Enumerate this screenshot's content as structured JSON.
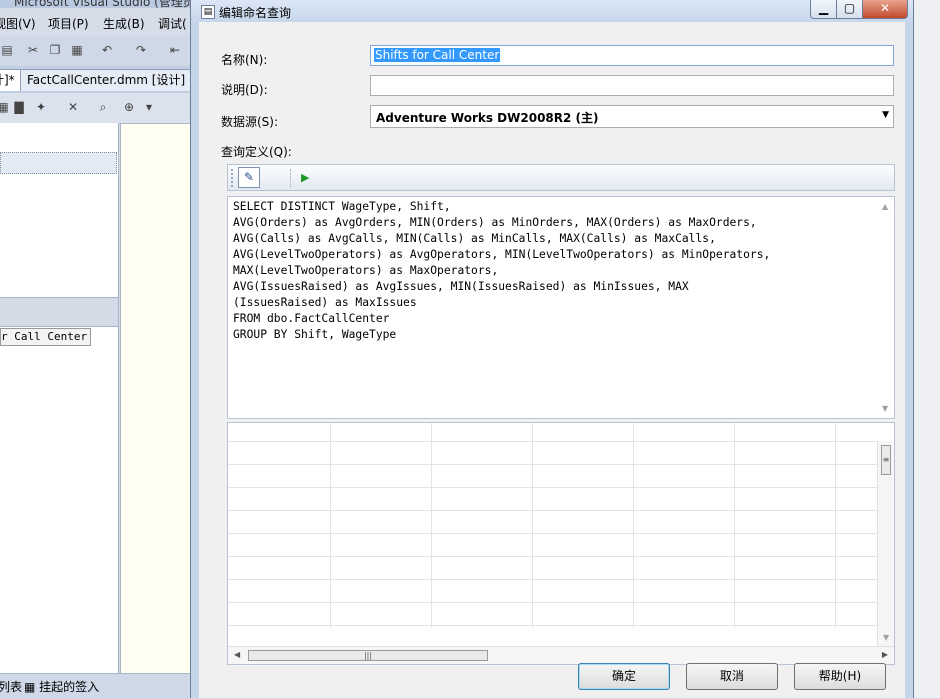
{
  "vs": {
    "title": "Microsoft Visual Studio (管理员)",
    "menu": [
      "视图(V)",
      "项目(P)",
      "生成(B)",
      "调试("
    ],
    "tabs": {
      "active_fragment": "计]*",
      "fact": "FactCallCenter.dmm [设计]"
    },
    "left_item": "r Call Center",
    "status_tabs": [
      "列表",
      "挂起的签入"
    ]
  },
  "dialog": {
    "title": "编辑命名查询",
    "name_label": "名称(N):",
    "name_value": "Shifts for Call Center",
    "description_label": "说明(D):",
    "description_value": "",
    "datasource_label": "数据源(S):",
    "datasource_value": "Adventure Works DW2008R2 (主)",
    "query_label": "查询定义(Q):",
    "sql_lines": [
      "SELECT DISTINCT WageType, Shift,",
      "AVG(Orders) as AvgOrders, MIN(Orders) as MinOrders, MAX(Orders) as MaxOrders,",
      "AVG(Calls) as AvgCalls, MIN(Calls) as MinCalls, MAX(Calls) as MaxCalls,",
      "AVG(LevelTwoOperators) as AvgOperators, MIN(LevelTwoOperators) as MinOperators,",
      "MAX(LevelTwoOperators) as MaxOperators,",
      "AVG(IssuesRaised) as AvgIssues, MIN(IssuesRaised) as MinIssues, MAX",
      "(IssuesRaised) as MaxIssues",
      "FROM dbo.FactCallCenter",
      "GROUP BY Shift, WageType"
    ],
    "buttons": {
      "ok": "确定",
      "cancel": "取消",
      "help": "帮助(H)"
    }
  },
  "icons": {
    "close": "close-icon",
    "minimize": "minimize-icon",
    "maximize": "maximize-icon",
    "run": "play-icon",
    "edit": "edit-sql-icon"
  }
}
